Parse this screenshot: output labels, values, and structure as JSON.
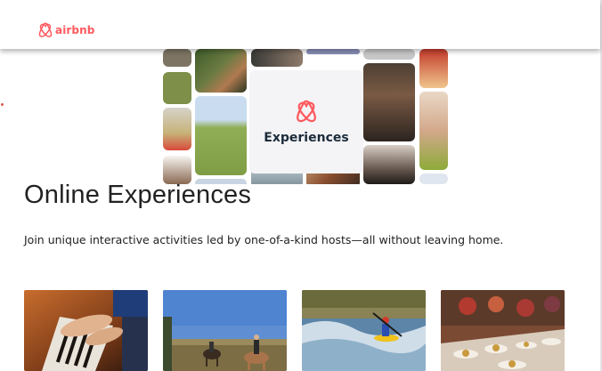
{
  "header": {
    "logo_text": "airbnb",
    "logo_icon": "airbnb-logo-icon",
    "brand_color": "#ff5a5f"
  },
  "hero": {
    "title": "Experiences",
    "icon": "airbnb-logo-icon"
  },
  "main": {
    "heading": "Online Experiences",
    "subtitle": "Join unique interactive activities led by one-of-a-kind hosts—all without leaving home."
  },
  "cards": [
    {
      "image": "piano-hands-photo"
    },
    {
      "image": "horseback-riding-photo"
    },
    {
      "image": "kayak-whitewater-photo"
    },
    {
      "image": "dining-table-photo"
    }
  ]
}
